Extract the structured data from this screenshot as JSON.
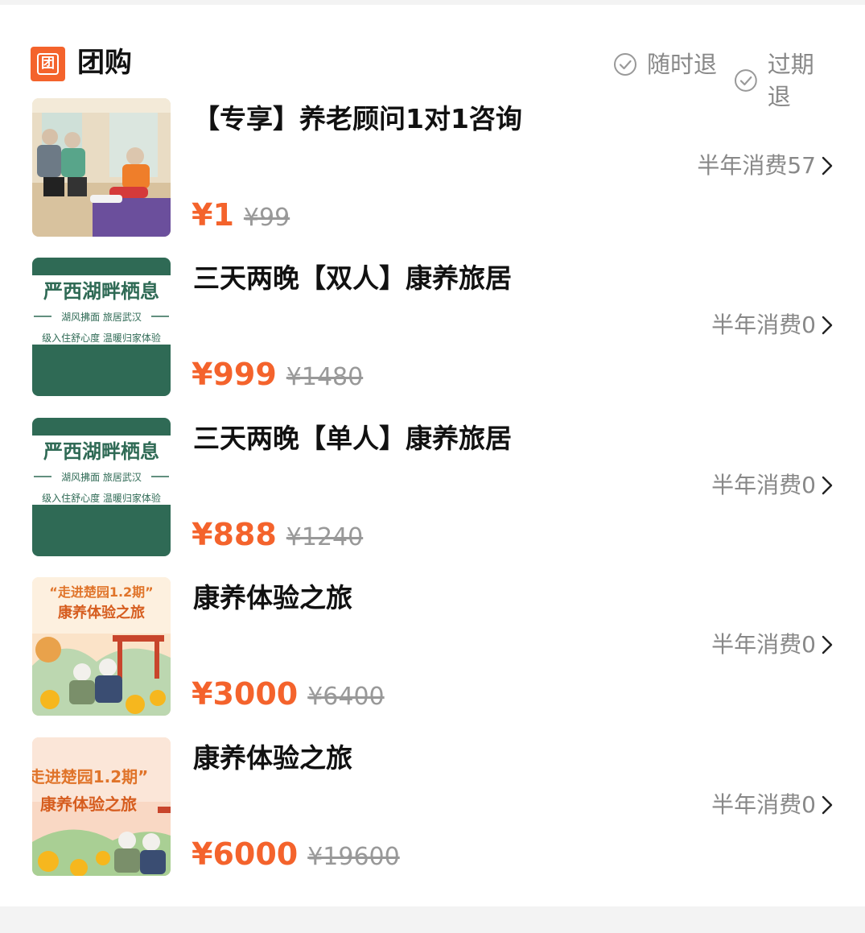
{
  "header": {
    "logo_char": "团",
    "title": "团购",
    "policies": [
      "随时退",
      "过期退"
    ]
  },
  "deals": [
    {
      "title": "【专享】养老顾问1对1咨询",
      "sales": "半年消费57",
      "price": "¥1",
      "original_price": "¥99",
      "thumb": {
        "type": "photo",
        "desc_icon": "elderly-fitness-photo"
      }
    },
    {
      "title": "三天两晚【双人】康养旅居",
      "sales": "半年消费0",
      "price": "¥999",
      "original_price": "¥1480",
      "thumb": {
        "type": "poster",
        "headline": "严西湖畔栖息",
        "line1": "湖风拂面 旅居武汉",
        "line2": "级入住舒心度  温暖归家体验"
      }
    },
    {
      "title": "三天两晚【单人】康养旅居",
      "sales": "半年消费0",
      "price": "¥888",
      "original_price": "¥1240",
      "thumb": {
        "type": "poster",
        "headline": "严西湖畔栖息",
        "line1": "湖风拂面 旅居武汉",
        "line2": "级入住舒心度  温暖归家体验"
      }
    },
    {
      "title": "康养体验之旅",
      "sales": "半年消费0",
      "price": "¥3000",
      "original_price": "¥6400",
      "thumb": {
        "type": "illustration",
        "headline": "“走进楚园1.2期”",
        "sub": "康养体验之旅"
      }
    },
    {
      "title": "康养体验之旅",
      "sales": "半年消费0",
      "price": "¥6000",
      "original_price": "¥19600",
      "thumb": {
        "type": "illustration",
        "headline": "走进楚园1.2期”",
        "sub": "康养体验之旅"
      }
    }
  ],
  "colors": {
    "accent": "#f4632c",
    "poster_green": "#2f6a55",
    "muted": "#888888"
  }
}
